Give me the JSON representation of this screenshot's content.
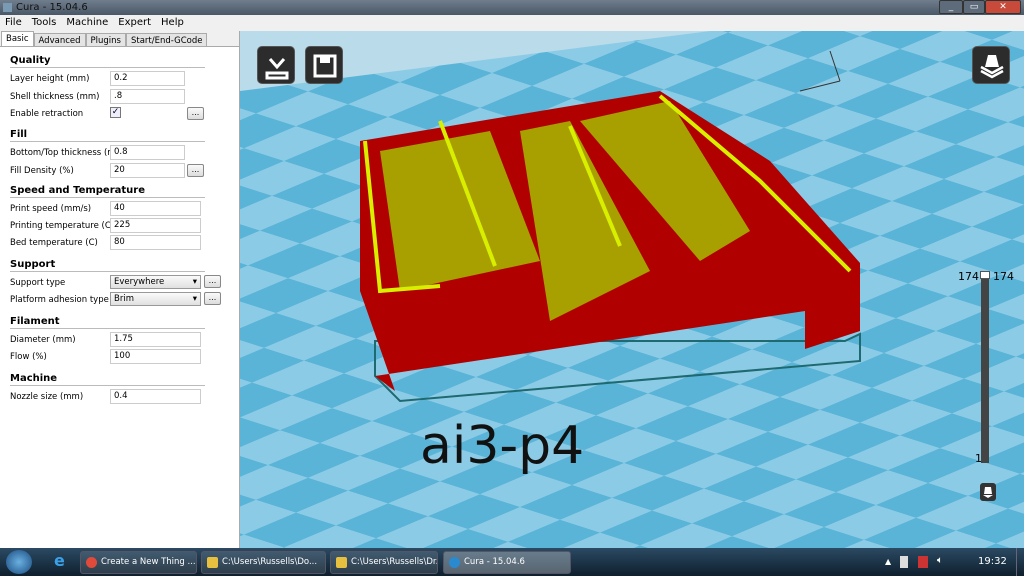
{
  "window": {
    "title": "Cura - 15.04.6"
  },
  "menu": [
    "File",
    "Tools",
    "Machine",
    "Expert",
    "Help"
  ],
  "tabs": [
    "Basic",
    "Advanced",
    "Plugins",
    "Start/End-GCode"
  ],
  "sections": {
    "quality": {
      "title": "Quality",
      "layer_height_label": "Layer height (mm)",
      "layer_height": "0.2",
      "shell_label": "Shell thickness (mm)",
      "shell": ".8",
      "retraction_label": "Enable retraction",
      "retraction": "✓"
    },
    "fill": {
      "title": "Fill",
      "bt_label": "Bottom/Top thickness (mm)",
      "bt": "0.8",
      "density_label": "Fill Density (%)",
      "density": "20"
    },
    "speed": {
      "title": "Speed and Temperature",
      "print_speed_label": "Print speed (mm/s)",
      "print_speed": "40",
      "print_temp_label": "Printing temperature (C)",
      "print_temp": "225",
      "bed_temp_label": "Bed temperature (C)",
      "bed_temp": "80"
    },
    "support": {
      "title": "Support",
      "type_label": "Support type",
      "type": "Everywhere",
      "adhesion_label": "Platform adhesion type",
      "adhesion": "Brim"
    },
    "filament": {
      "title": "Filament",
      "diameter_label": "Diameter (mm)",
      "diameter": "1.75",
      "flow_label": "Flow (%)",
      "flow": "100"
    },
    "machine": {
      "title": "Machine",
      "nozzle_label": "Nozzle size (mm)",
      "nozzle": "0.4"
    }
  },
  "more_label": "...",
  "viewport": {
    "model_label": "ai3-p4",
    "layer_top_left": "174",
    "layer_top_right": "174",
    "layer_bottom": "1",
    "layer_fraction": 1.0
  },
  "taskbar": {
    "items": [
      "Create a New Thing ...",
      "C:\\Users\\Russells\\Do...",
      "C:\\Users\\Russells\\Dr...",
      "Cura - 15.04.6"
    ],
    "clock": "19:32"
  },
  "colors": {
    "model": "#b00000",
    "outline": "#d8f000",
    "infill": "#a8a000",
    "bed": "#5ab4d8"
  }
}
